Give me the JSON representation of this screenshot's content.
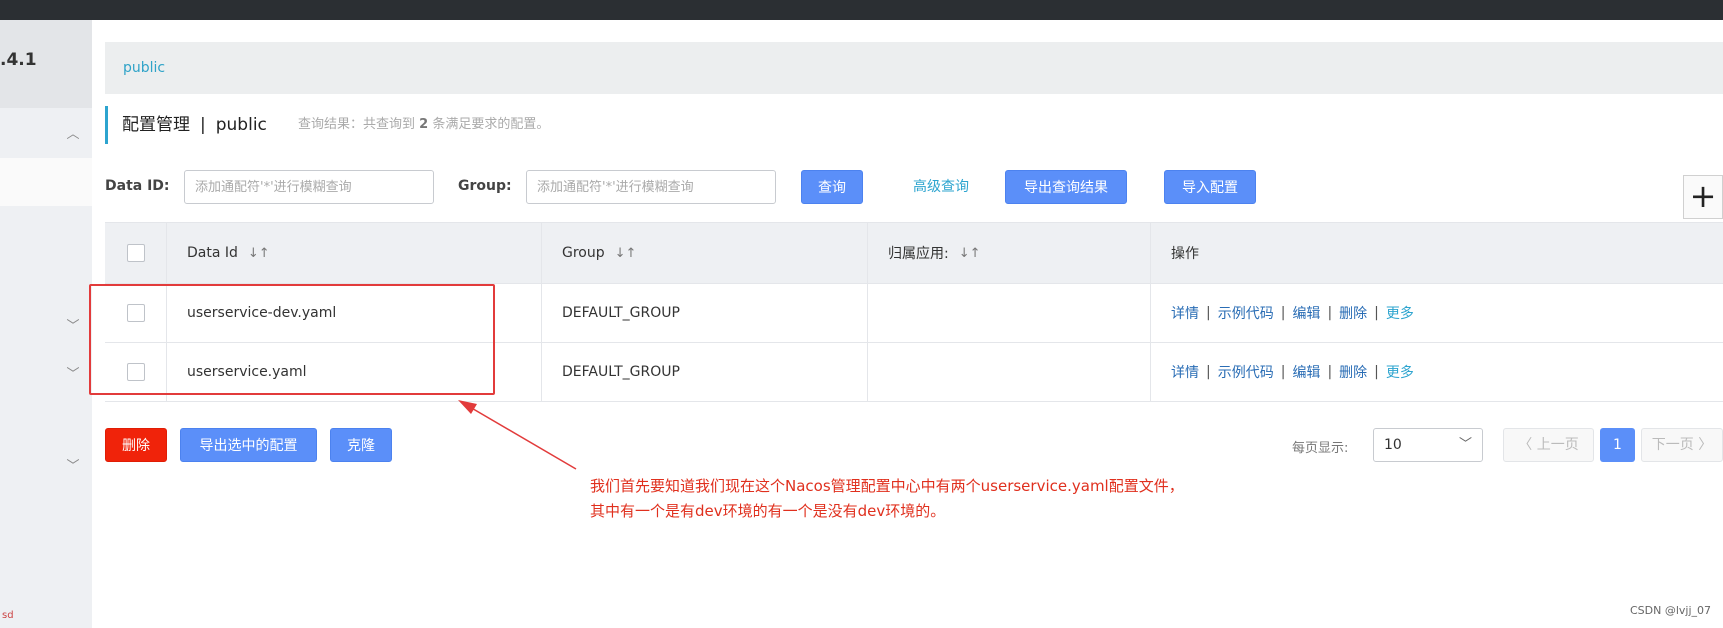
{
  "sidebar": {
    "version": ".4.1",
    "footer_text": "sd"
  },
  "namespace": {
    "current": "public"
  },
  "title": {
    "main": "配置管理",
    "separator": "|",
    "namespace": "public",
    "result_prefix": "查询结果：共查询到",
    "result_count": "2",
    "result_suffix": "条满足要求的配置。"
  },
  "search": {
    "dataid_label": "Data ID:",
    "dataid_placeholder": "添加通配符'*'进行模糊查询",
    "group_label": "Group:",
    "group_placeholder": "添加通配符'*'进行模糊查询",
    "query_button": "查询",
    "advanced_link": "高级查询",
    "export_button": "导出查询结果",
    "import_button": "导入配置",
    "add_icon": "plus-icon"
  },
  "table": {
    "headers": {
      "data_id": "Data Id",
      "group": "Group",
      "app": "归属应用:",
      "ops": "操作",
      "sort_icon": "↓↑"
    },
    "rows": [
      {
        "data_id": "userservice-dev.yaml",
        "group": "DEFAULT_GROUP",
        "app": ""
      },
      {
        "data_id": "userservice.yaml",
        "group": "DEFAULT_GROUP",
        "app": ""
      }
    ],
    "ops": {
      "detail": "详情",
      "sample": "示例代码",
      "edit": "编辑",
      "delete": "删除",
      "more": "更多",
      "pipe": "|"
    }
  },
  "actions": {
    "delete_button": "删除",
    "export_selected_button": "导出选中的配置",
    "clone_button": "克隆"
  },
  "pagination": {
    "per_page_label": "每页显示:",
    "per_page_value": "10",
    "prev": "上一页",
    "current": "1",
    "next": "下一页"
  },
  "annotation": {
    "line1": "我们首先要知道我们现在这个Nacos管理配置中心中有两个userservice.yaml配置文件，",
    "line2": "其中有一个是有dev环境的有一个是没有dev环境的。",
    "color": "#e0301e"
  },
  "watermark": "CSDN @lvjj_07"
}
